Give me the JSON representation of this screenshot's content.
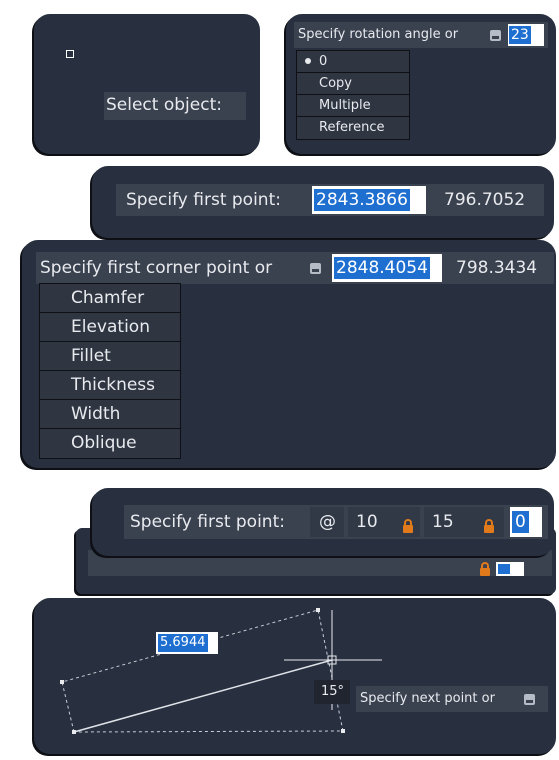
{
  "select_object": {
    "prompt": "Select object:"
  },
  "rotation": {
    "prompt": "Specify rotation angle or",
    "value": "23",
    "options": [
      "0",
      "Copy",
      "Multiple",
      "Reference"
    ]
  },
  "first_point": {
    "prompt": "Specify first point:",
    "x_value": "2843.3866",
    "y_value": "796.7052"
  },
  "corner": {
    "prompt": "Specify first corner point or",
    "x_value": "2848.4054",
    "y_value": "798.3434",
    "options": [
      "Chamfer",
      "Elevation",
      "Fillet",
      "Thickness",
      "Width",
      "Oblique"
    ]
  },
  "relative_point": {
    "prompt": "Specify first point:",
    "at_symbol": "@",
    "x_value": "10",
    "y_value": "15",
    "z_value": "0"
  },
  "next_point": {
    "distance": "5.6944",
    "angle": "15°",
    "prompt": "Specify next point or"
  },
  "colors": {
    "panel": "#283040",
    "bar": "#3a414f",
    "selection": "#1e6fd0",
    "lock": "#e07a1a"
  }
}
